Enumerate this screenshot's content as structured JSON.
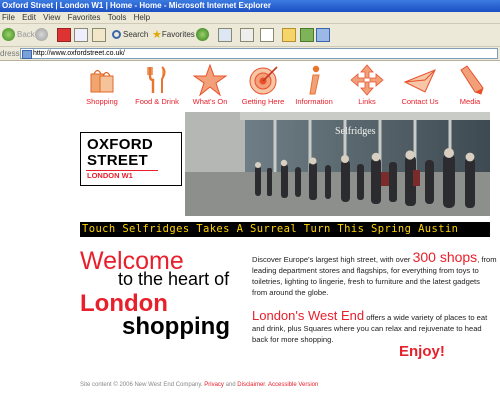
{
  "window": {
    "title": "Oxford Street | London W1 | Home - Home - Microsoft Internet Explorer"
  },
  "menu": [
    "File",
    "Edit",
    "View",
    "Favorites",
    "Tools",
    "Help"
  ],
  "toolbar": {
    "back_label": "Back",
    "search_label": "Search",
    "favorites_label": "Favorites"
  },
  "address": {
    "label": "dress",
    "url": "http://www.oxfordstreet.co.uk/"
  },
  "nav": [
    {
      "label": "Shopping",
      "icon": "shopping-bags-icon"
    },
    {
      "label": "Food & Drink",
      "icon": "cutlery-icon"
    },
    {
      "label": "What's On",
      "icon": "star-icon"
    },
    {
      "label": "Getting Here",
      "icon": "target-icon"
    },
    {
      "label": "Information",
      "icon": "info-icon"
    },
    {
      "label": "Links",
      "icon": "arrows-icon"
    },
    {
      "label": "Contact Us",
      "icon": "envelope-icon"
    },
    {
      "label": "Media",
      "icon": "pencil-icon"
    }
  ],
  "logo": {
    "line1": "OXFORD",
    "line2": "STREET",
    "line3": "LONDON W1"
  },
  "hero": {
    "store_sign": "Selfridges"
  },
  "ticker": "Touch    Selfridges Takes A Surreal Turn This Spring    Austin",
  "welcome": {
    "line1": "Welcome",
    "line2": "to the heart of",
    "line3": "London",
    "line4": "shopping"
  },
  "intro": {
    "p1_before": "Discover Europe's largest high street, with over ",
    "p1_highlight": "300 shops",
    "p1_after": ", from leading department stores and flagships, for everything from toys to toiletries, lighting to lingerie, fresh to furniture and the latest gadgets from around the globe.",
    "p2_highlight": "London's West End",
    "p2_after": " offers a wide variety of places to eat and drink, plus Squares where you can relax and rejuvenate to head back for more shopping.",
    "enjoy": "Enjoy!"
  },
  "footer": {
    "text": "Site content © 2006 New West End Company. ",
    "privacy": "Privacy",
    "and": " and ",
    "disclaimer": "Disclaimer",
    "accessible": "Accessible Version"
  },
  "colors": {
    "brand_red": "#e8202c",
    "ticker_text": "#ffd400",
    "titlebar_blue": "#1c4fc4"
  }
}
